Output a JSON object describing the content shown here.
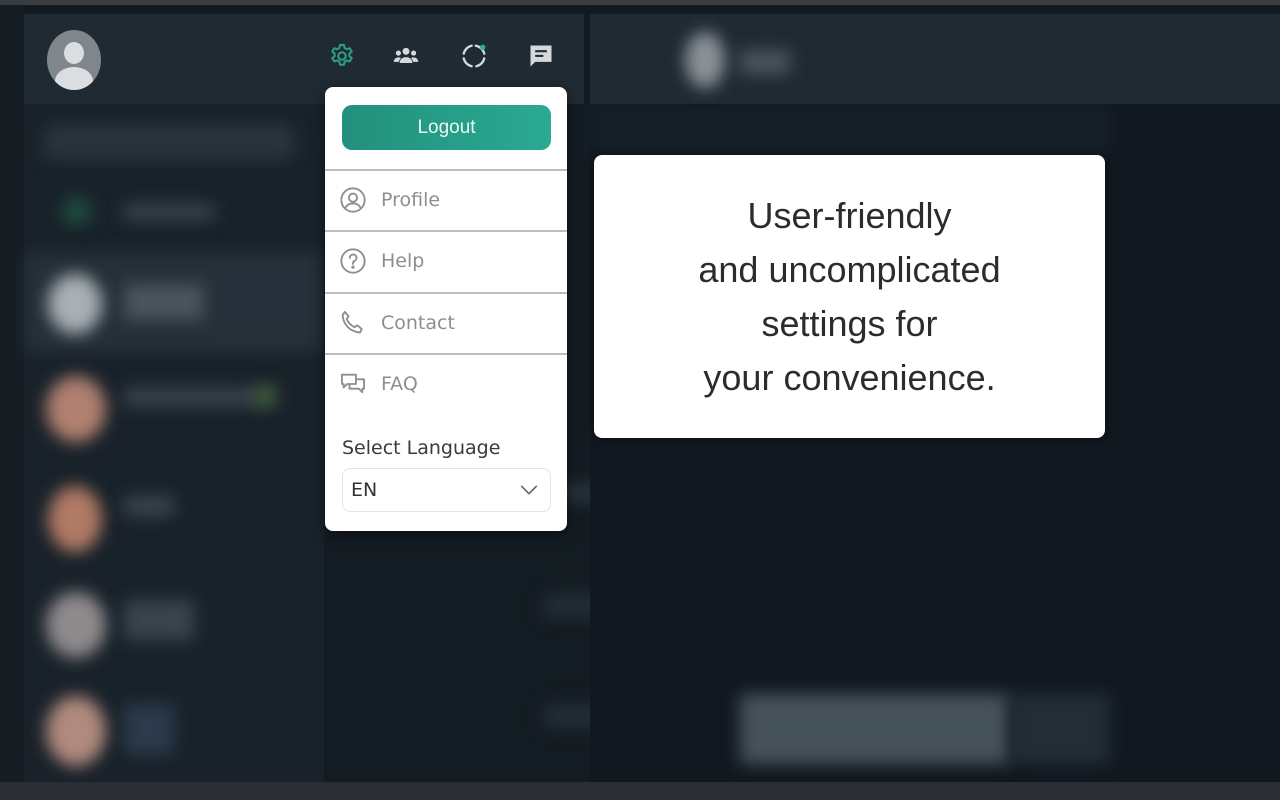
{
  "header": {
    "avatar": "default-user-avatar",
    "icons": [
      {
        "name": "settings-icon",
        "color": "#2a9d84",
        "active": true
      },
      {
        "name": "communities-icon",
        "color": "#d6d9dc"
      },
      {
        "name": "status-icon",
        "color": "#d6d9dc",
        "badge_color": "#25b08f"
      },
      {
        "name": "new-chat-icon",
        "color": "#d6d9dc"
      }
    ]
  },
  "menu": {
    "logout_label": "Logout",
    "items": [
      {
        "label": "Profile",
        "icon": "profile-icon"
      },
      {
        "label": "Help",
        "icon": "help-icon"
      },
      {
        "label": "Contact",
        "icon": "phone-icon"
      },
      {
        "label": "FAQ",
        "icon": "faq-icon"
      }
    ],
    "language_label": "Select Language",
    "language_value": "EN"
  },
  "callout": {
    "lines": [
      "User-friendly",
      "and uncomplicated",
      "settings for",
      "your convenience."
    ]
  },
  "colors": {
    "accent": "#2a9d84",
    "background": "#121a21",
    "header": "#1f2a33"
  }
}
